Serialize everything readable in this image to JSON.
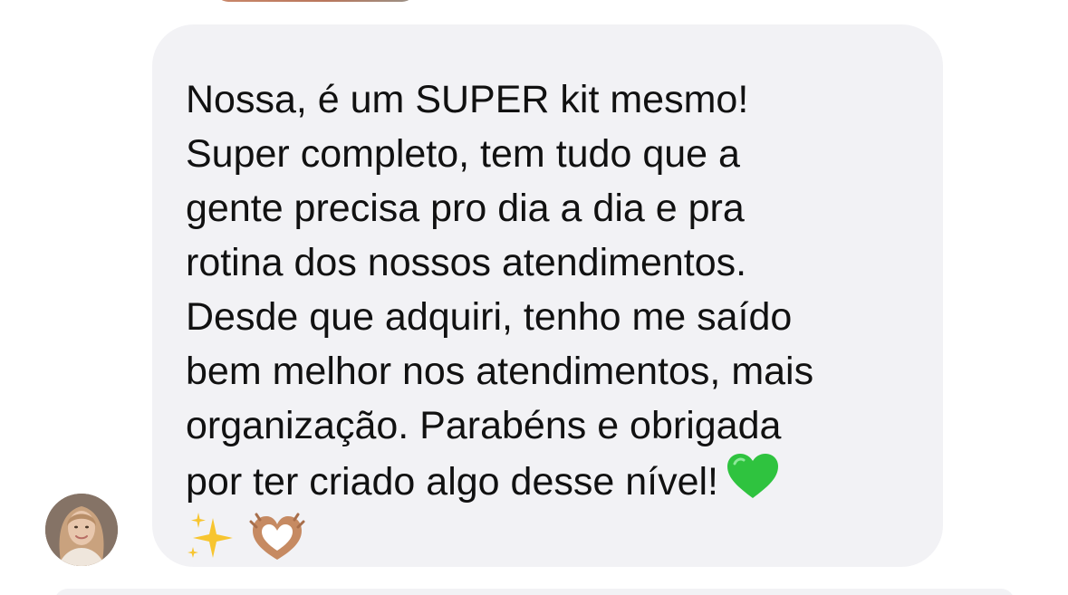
{
  "message": {
    "lines": [
      "Nossa, é um SUPER kit mesmo!",
      "Super completo, tem tudo que a",
      "gente precisa pro dia a dia e pra",
      "rotina dos nossos atendimentos.",
      "Desde que adquiri, tenho me saído",
      "bem melhor nos atendimentos, mais",
      "organização. Parabéns e obrigada",
      "por ter criado algo desse nível!"
    ],
    "emojis": [
      "green-heart",
      "sparkles",
      "heart-hands"
    ]
  },
  "colors": {
    "bubble_bg": "#f2f2f5",
    "text": "#111111",
    "green_heart": "#2fc33f",
    "sparkles": "#f7c530",
    "hands": "#c68a62"
  }
}
